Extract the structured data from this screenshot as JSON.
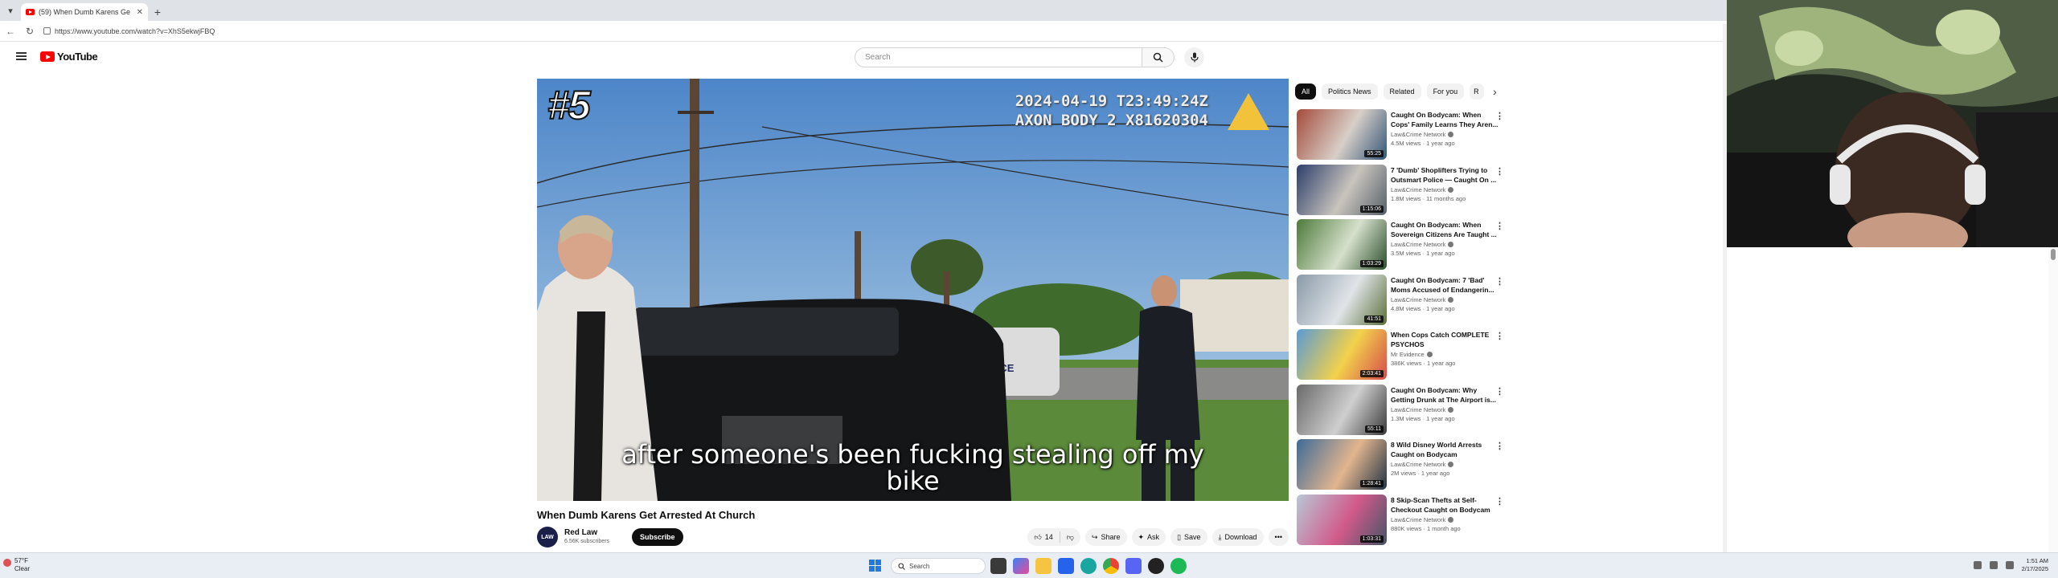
{
  "browser": {
    "tab_title": "(59) When Dumb Karens Ge",
    "url": "https://www.youtube.com/watch?v=XhS5ekwjFBQ"
  },
  "masthead": {
    "logo_text": "YouTube",
    "search_placeholder": "Search"
  },
  "player": {
    "rank": "#5",
    "timestamp_line1": "2024-04-19 T23:49:24Z",
    "timestamp_line2": "AXON BODY 2 X81620304",
    "caption_line1": "after someone's been fucking stealing off my",
    "caption_line2": "bike",
    "car_text": "POLICE"
  },
  "video": {
    "title": "When Dumb Karens Get Arrested At Church",
    "channel": "Red Law",
    "subscribers": "6.56K subscribers",
    "avatar_text": "LAW",
    "subscribe_label": "Subscribe",
    "likes": "14",
    "share_label": "Share",
    "ask_label": "Ask",
    "save_label": "Save",
    "download_label": "Download"
  },
  "chips": [
    "All",
    "Politics News",
    "Related",
    "For you",
    "R"
  ],
  "recommendations": [
    {
      "title": "Caught On Bodycam: When Cops' Family Learns They Aren...",
      "channel": "Law&Crime Network",
      "meta": "4.5M views · 1 year ago",
      "duration": "55:25",
      "colors": [
        "#a44b3b",
        "#d8cfc8",
        "#335577"
      ]
    },
    {
      "title": "7 'Dumb' Shoplifters Trying to Outsmart Police — Caught On ...",
      "channel": "Law&Crime Network",
      "meta": "1.8M views · 11 months ago",
      "duration": "1:15:06",
      "colors": [
        "#2c3e6b",
        "#c9c4bd",
        "#55606b"
      ]
    },
    {
      "title": "Caught On Bodycam: When Sovereign Citizens Are Taught ...",
      "channel": "Law&Crime Network",
      "meta": "3.5M views · 1 year ago",
      "duration": "1:03:29",
      "colors": [
        "#4d7a3a",
        "#d6e0cc",
        "#2b4e2b"
      ]
    },
    {
      "title": "Caught On Bodycam: 7 'Bad' Moms Accused of Endangerin...",
      "channel": "Law&Crime Network",
      "meta": "4.8M views · 1 year ago",
      "duration": "41:51",
      "colors": [
        "#8a9aa8",
        "#e0e4e8",
        "#5b6f3a"
      ]
    },
    {
      "title": "When Cops Catch COMPLETE PSYCHOS",
      "channel": "Mr Evidence",
      "meta": "386K views · 1 year ago",
      "duration": "2:03:41",
      "colors": [
        "#5a9bd4",
        "#f2d24b",
        "#d64b4b"
      ]
    },
    {
      "title": "Caught On Bodycam: Why Getting Drunk at The Airport is...",
      "channel": "Law&Crime Network",
      "meta": "1.3M views · 1 year ago",
      "duration": "55:11",
      "colors": [
        "#6a6a6a",
        "#cfcfcf",
        "#3a3a3a"
      ]
    },
    {
      "title": "8 Wild Disney World Arrests Caught on Bodycam",
      "channel": "Law&Crime Network",
      "meta": "2M views · 1 year ago",
      "duration": "1:28:41",
      "colors": [
        "#3d6b96",
        "#e2b58e",
        "#223344"
      ]
    },
    {
      "title": "8 Skip-Scan Thefts at Self-Checkout Caught on Bodycam",
      "channel": "Law&Crime Network",
      "meta": "880K views · 1 month ago",
      "duration": "1:03:31",
      "colors": [
        "#b8c7d6",
        "#d15a8a",
        "#445566"
      ]
    }
  ],
  "taskbar": {
    "weather_temp": "57°F",
    "weather_desc": "Clear",
    "search_placeholder": "Search",
    "time": "1:51 AM",
    "date": "2/17/2025"
  },
  "colors": {
    "youtube_red": "#ff0000",
    "subscribe_bg": "#0f0f0f",
    "chip_bg": "#f2f2f2"
  }
}
